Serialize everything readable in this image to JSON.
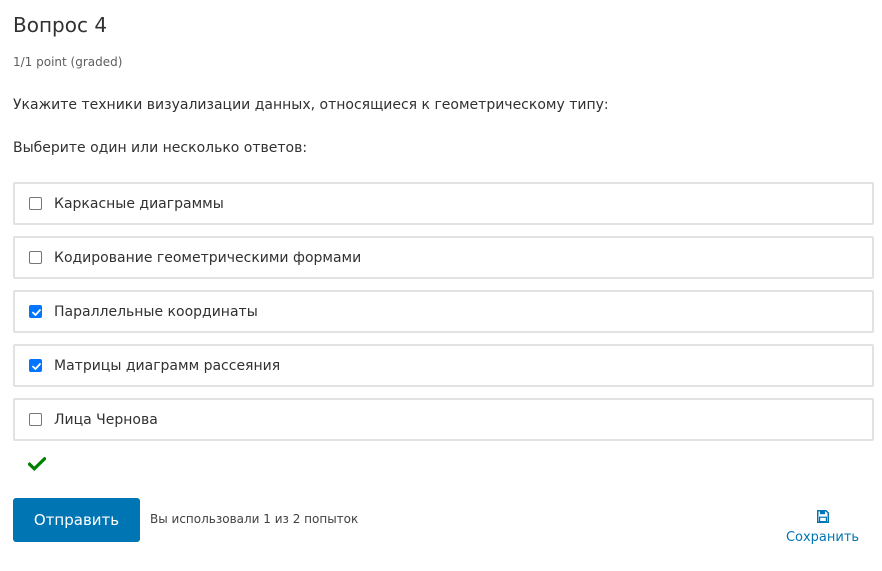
{
  "question": {
    "title": "Вопрос 4",
    "points": "1/1 point (graded)",
    "prompt": "Укажите техники визуализации данных, относящиеся к геометрическому типу:",
    "instruction": "Выберите один или несколько ответов:"
  },
  "choices": [
    {
      "label": "Каркасные диаграммы",
      "checked": false
    },
    {
      "label": "Кодирование геометрическими формами",
      "checked": false
    },
    {
      "label": "Параллельные координаты",
      "checked": true
    },
    {
      "label": "Матрицы диаграмм рассеяния",
      "checked": true
    },
    {
      "label": "Лица Чернова",
      "checked": false
    }
  ],
  "result": {
    "icon": "checkmark-icon",
    "color": "#008100"
  },
  "actions": {
    "submit_label": "Отправить",
    "attempts_text": "Вы использовали 1 из 2 попыток",
    "save_label": "Сохранить",
    "save_icon": "floppy-disk-icon"
  },
  "colors": {
    "accent": "#0075b4",
    "checkbox_checked": "#0075ff",
    "border": "#e2e2e2"
  }
}
